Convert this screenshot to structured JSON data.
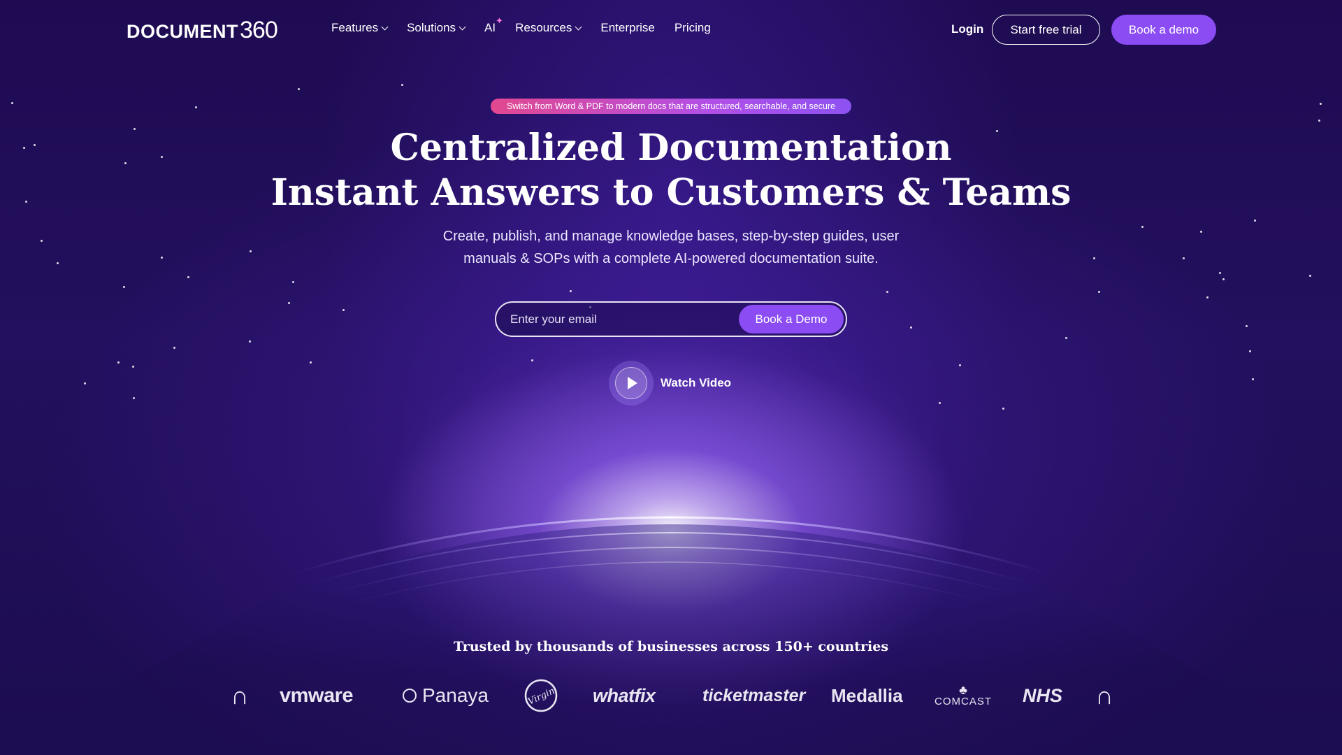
{
  "nav": {
    "logo_text": "DOCUMENT",
    "logo_number": "360",
    "items": [
      {
        "label": "Features",
        "has_dropdown": true
      },
      {
        "label": "Solutions",
        "has_dropdown": true
      },
      {
        "label": "AI",
        "has_dropdown": false,
        "badge_icon": "sparkle-icon"
      },
      {
        "label": "Resources",
        "has_dropdown": true
      },
      {
        "label": "Enterprise",
        "has_dropdown": false
      },
      {
        "label": "Pricing",
        "has_dropdown": false
      }
    ],
    "login_label": "Login",
    "trial_label": "Start free trial",
    "demo_label": "Book a demo"
  },
  "hero": {
    "announcement": "Switch from Word & PDF to modern docs that are structured, searchable, and secure",
    "headline_line1": "Centralized Documentation",
    "headline_line2": "Instant Answers to Customers & Teams",
    "subheadline_line1": "Create, publish, and manage knowledge bases, step-by-step guides, user",
    "subheadline_line2": "manuals & SOPs with a complete AI-powered documentation suite.",
    "email_placeholder": "Enter your email",
    "email_value": "",
    "cta_label": "Book a Demo",
    "watch_label": "Watch Video"
  },
  "trusted": {
    "heading": "Trusted by thousands of businesses across 150+ countries",
    "logos": [
      {
        "name": "arch-icon",
        "text": "∩"
      },
      {
        "name": "vmware-logo",
        "text": "vmware"
      },
      {
        "name": "panaya-logo",
        "text": "Panaya"
      },
      {
        "name": "virgin-logo",
        "text": "Virgin"
      },
      {
        "name": "whatfix-logo",
        "text": "whatfix"
      },
      {
        "name": "ticketmaster-logo",
        "text": "ticketmaster"
      },
      {
        "name": "medallia-logo",
        "text": "Medallia"
      },
      {
        "name": "comcast-logo",
        "text": "COMCAST"
      },
      {
        "name": "nhs-logo",
        "text": "NHS"
      },
      {
        "name": "arch-icon",
        "text": "∩"
      }
    ]
  },
  "colors": {
    "background": "#1f0b52",
    "accent": "#8b4cf4",
    "pill_start": "#e2488f",
    "pill_end": "#8d52f2",
    "sparkle": "#ff7adf"
  }
}
